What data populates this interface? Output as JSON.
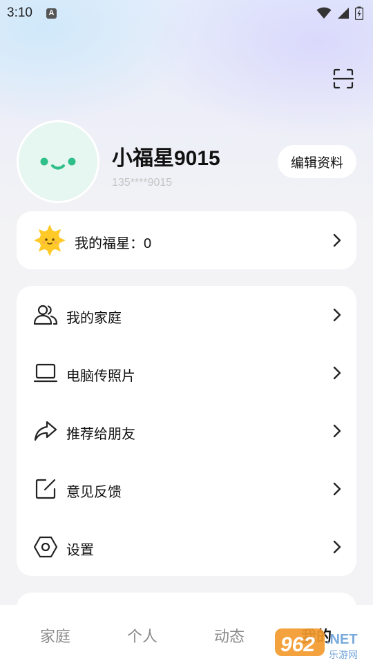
{
  "status_bar": {
    "time": "3:10",
    "notification_icon": "A",
    "icons": [
      "wifi-icon",
      "signal-icon",
      "battery-charging-icon"
    ]
  },
  "header": {
    "scan_icon": "scan-icon"
  },
  "profile": {
    "avatar_icon": "smiley-face-avatar",
    "username": "小福星9015",
    "phone": "135****9015",
    "edit_label": "编辑资料"
  },
  "stars": {
    "icon": "sun-icon",
    "label": "我的福星：0"
  },
  "menu": {
    "items": [
      {
        "label": "我的家庭",
        "icon": "users-icon"
      },
      {
        "label": "电脑传照片",
        "icon": "laptop-icon"
      },
      {
        "label": "推荐给朋友",
        "icon": "share-icon"
      },
      {
        "label": "意见反馈",
        "icon": "edit-feedback-icon"
      },
      {
        "label": "设置",
        "icon": "settings-hexagon-icon"
      }
    ]
  },
  "tabbar": {
    "tabs": [
      {
        "label": "家庭"
      },
      {
        "label": "个人"
      },
      {
        "label": "动态"
      },
      {
        "label": "我的"
      }
    ],
    "active_index": 3
  },
  "watermark": {
    "text_number": "962",
    "text_net": ".NET",
    "text_cn": "乐游网"
  },
  "colors": {
    "avatar_bg": "#e6f6f0",
    "avatar_features": "#2fbf8a",
    "sun": "#ffc928",
    "card_bg": "#ffffff",
    "text_primary": "#111111",
    "text_secondary": "#c4c4c4",
    "tab_inactive": "#8a8a8a"
  }
}
